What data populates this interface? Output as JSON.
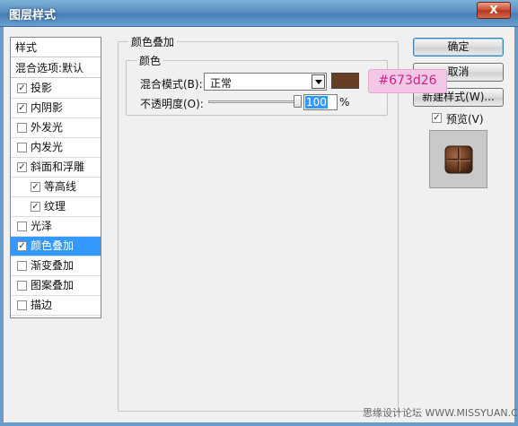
{
  "window": {
    "title": "图层样式",
    "close": "X"
  },
  "sidebar": {
    "header": "样式",
    "blend_default": "混合选项:默认",
    "items": [
      {
        "label": "投影",
        "checked": true
      },
      {
        "label": "内阴影",
        "checked": true
      },
      {
        "label": "外发光",
        "checked": false
      },
      {
        "label": "内发光",
        "checked": false
      },
      {
        "label": "斜面和浮雕",
        "checked": true
      },
      {
        "label": "等高线",
        "checked": true
      },
      {
        "label": "纹理",
        "checked": true
      },
      {
        "label": "光泽",
        "checked": false
      },
      {
        "label": "颜色叠加",
        "checked": true,
        "selected": true
      },
      {
        "label": "渐变叠加",
        "checked": false
      },
      {
        "label": "图案叠加",
        "checked": false
      },
      {
        "label": "描边",
        "checked": false
      }
    ]
  },
  "panel": {
    "title": "颜色叠加",
    "group_title": "颜色",
    "blend_mode_label": "混合模式(B):",
    "blend_mode_value": "正常",
    "opacity_label": "不透明度(O):",
    "opacity_value": "100",
    "opacity_unit": "%",
    "opacity_level": 1.0,
    "overlay_color": "#673d26",
    "color_callout": "#673d26"
  },
  "buttons": {
    "ok": "确定",
    "cancel": "取消",
    "new_style": "新建样式(W)...",
    "preview_label": "预览(V)",
    "preview_checked": true
  },
  "watermark": "思缘设计论坛 WWW.MISSYUAN.COM",
  "check_glyph": "✓"
}
